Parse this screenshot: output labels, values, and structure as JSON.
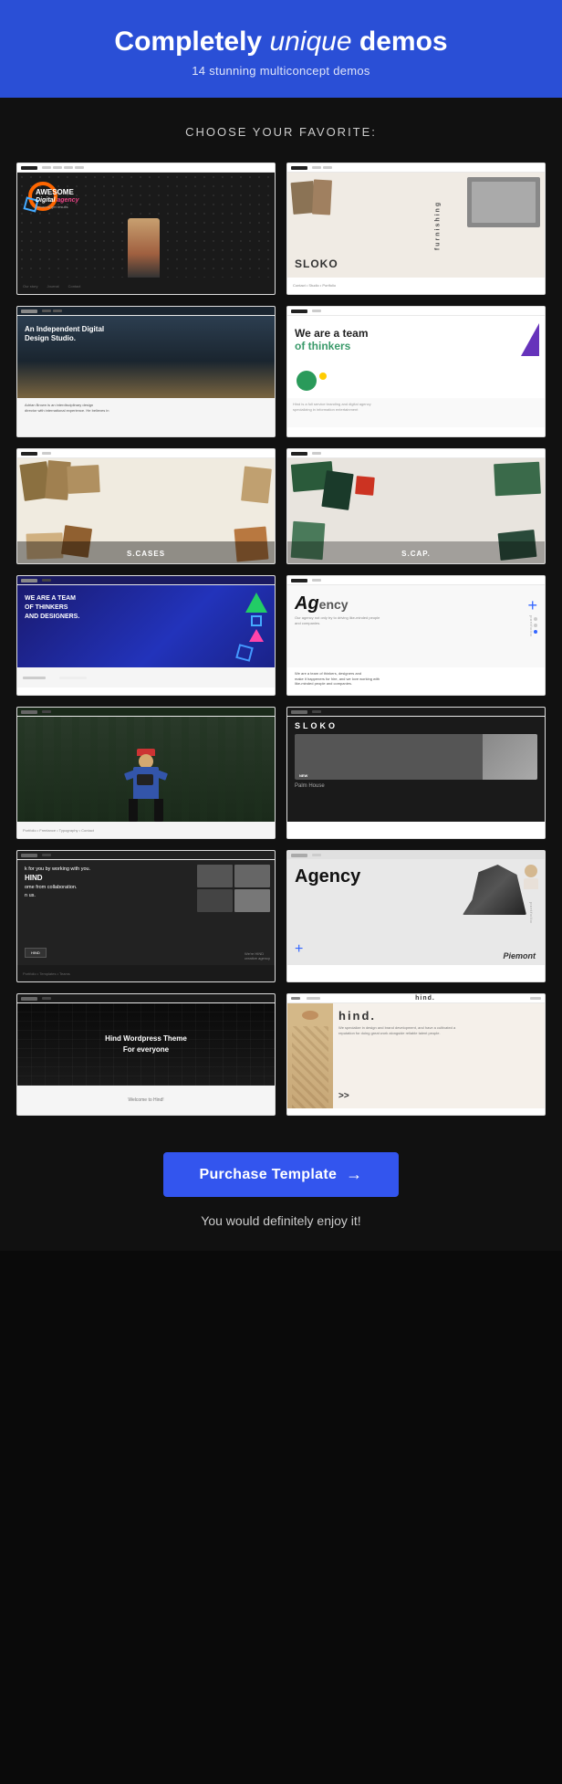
{
  "header": {
    "title_start": "Completely ",
    "title_unique": "unique ",
    "title_end": "demos",
    "subtitle": "14 stunning multiconcept demos"
  },
  "choose": {
    "label": "CHOOSE YOUR FAVORITE:"
  },
  "demos": [
    {
      "id": 1,
      "type": "dark-agency",
      "heading": "AWESOME\nDigital agency",
      "sub": "Driven to get results"
    },
    {
      "id": 2,
      "type": "sloko",
      "heading": "SLOKO",
      "sub": "furnishing"
    },
    {
      "id": 3,
      "type": "digital-studio",
      "heading": "An Independent Digital Design Studio.",
      "sub": "Adrian Brown is an interdisciplinary design director with international experience. He believes in"
    },
    {
      "id": 4,
      "type": "thinkers",
      "heading": "We are a team\nof thinkers",
      "sub": ""
    },
    {
      "id": 5,
      "type": "cases-light",
      "heading": "S.CASES",
      "sub": ""
    },
    {
      "id": 6,
      "type": "cases-dark",
      "heading": "S.CAP.",
      "sub": ""
    },
    {
      "id": 7,
      "type": "thinkers-dark",
      "heading": "WE ARE A TEAM\nOF THINKERS\nAND DESIGNERS.",
      "sub": ""
    },
    {
      "id": 8,
      "type": "agency-light",
      "heading": "Agency.",
      "sub": "Our agency not only try to driving like-minded people."
    },
    {
      "id": 9,
      "type": "photographer",
      "heading": "",
      "sub": ""
    },
    {
      "id": 10,
      "type": "sloko-shop",
      "sloko": "SLOKO",
      "palm": "Palm House"
    },
    {
      "id": 11,
      "type": "hind-collab",
      "text": "k for you by working with you.\nHIND\nome from collaboration.\nn us.",
      "btn": "HIND"
    },
    {
      "id": 12,
      "type": "agency-shoes",
      "heading": "Agency",
      "side": "portfolio",
      "piemont": "Piemont"
    },
    {
      "id": 13,
      "type": "hind-wp",
      "heading": "Hind Wordpress Theme\nFor everyone",
      "footer": "Welcome to Hind!"
    },
    {
      "id": 14,
      "type": "hind-brand",
      "hind": "hind.",
      "desc": "We specialize in design and brand development, and have a cultivated a reputation for doing great work alongside reliable talent people.",
      "arrows": ">>"
    }
  ],
  "cta": {
    "button_label": "Purchase Template",
    "arrow": "→",
    "enjoy": "You would definitely enjoy it!"
  }
}
